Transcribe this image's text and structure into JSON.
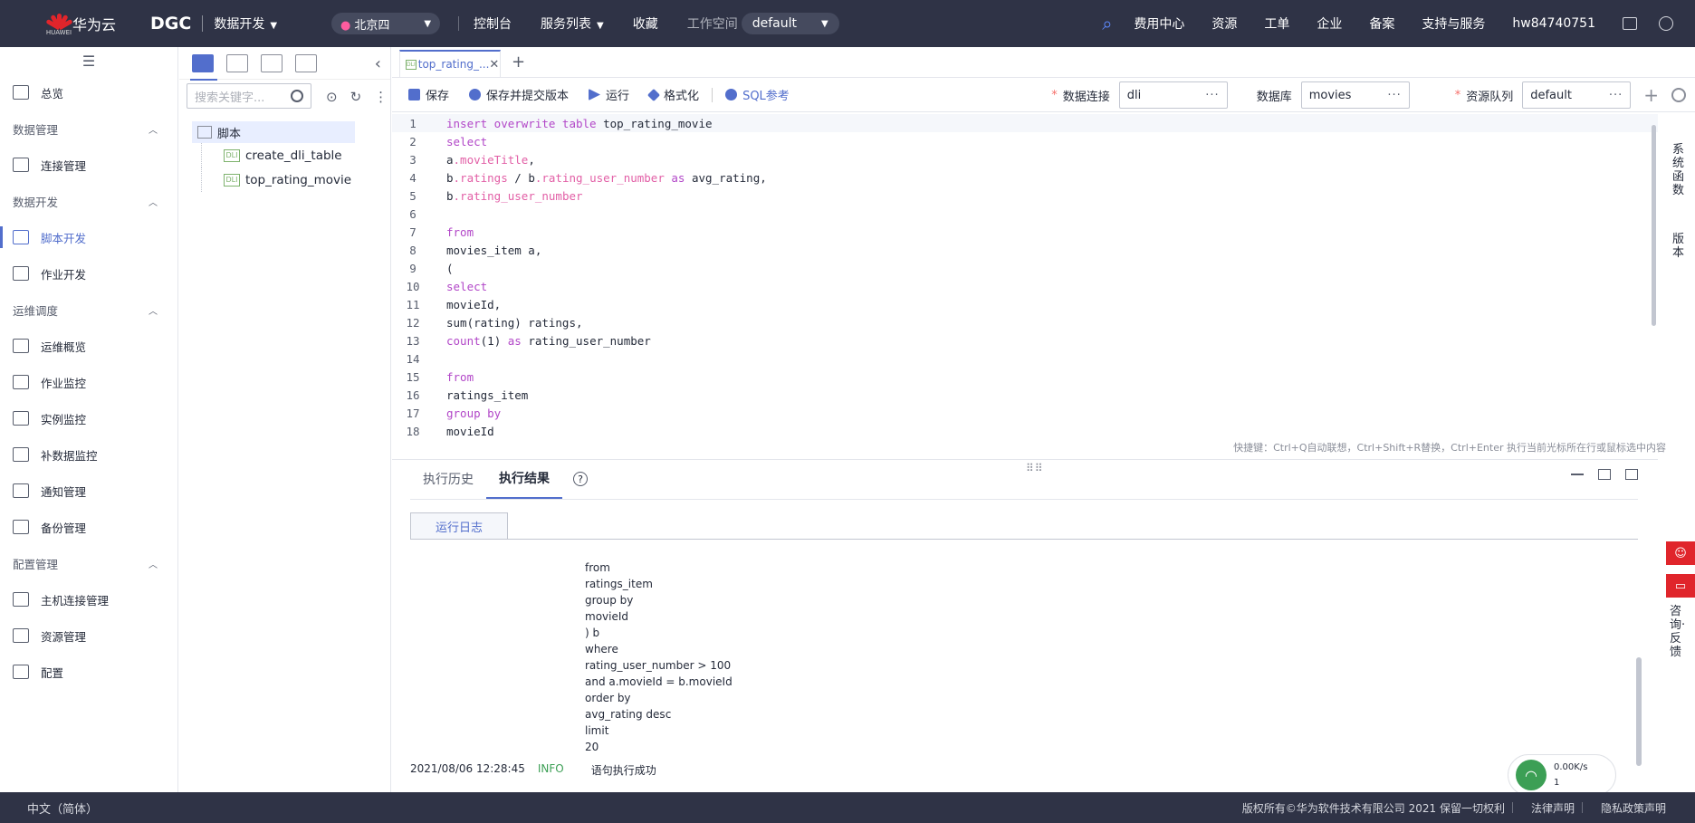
{
  "topbar": {
    "logo_sub": "HUAWEI",
    "brand": "华为云",
    "product": "DGC",
    "module": "数据开发",
    "region": "北京四",
    "nav": [
      "控制台",
      "服务列表",
      "收藏"
    ],
    "workspace_label": "工作空间",
    "workspace_value": "default",
    "right_links": [
      "费用中心",
      "资源",
      "工单",
      "企业",
      "备案",
      "支持与服务",
      "hw84740751"
    ]
  },
  "sidebar": {
    "overview": "总览",
    "groups": [
      {
        "title": "数据管理",
        "items": [
          "连接管理"
        ]
      },
      {
        "title": "数据开发",
        "items": [
          "脚本开发",
          "作业开发"
        ]
      },
      {
        "title": "运维调度",
        "items": [
          "运维概览",
          "作业监控",
          "实例监控",
          "补数据监控",
          "通知管理",
          "备份管理"
        ]
      },
      {
        "title": "配置管理",
        "items": [
          "主机连接管理",
          "资源管理",
          "配置"
        ]
      }
    ]
  },
  "explorer": {
    "search_placeholder": "搜索关键字...",
    "root": "脚本",
    "files": [
      "create_dli_table",
      "top_rating_movie"
    ],
    "file_icon_label": "DLI"
  },
  "editor": {
    "tab_label": "top_rating_...",
    "toolbar": {
      "save": "保存",
      "save_submit": "保存并提交版本",
      "run": "运行",
      "format": "格式化",
      "sql_ref": "SQL参考"
    },
    "fields": {
      "connection_label": "数据连接",
      "connection_value": "dli",
      "database_label": "数据库",
      "database_value": "movies",
      "queue_label": "资源队列",
      "queue_value": "default"
    },
    "shortcut_hint": "快捷键：Ctrl+Q自动联想，Ctrl+Shift+R替换，Ctrl+Enter 执行当前光标所在行或鼠标选中内容"
  },
  "results": {
    "tabs": [
      "执行历史",
      "执行结果"
    ],
    "help": "?",
    "log_tab": "运行日志",
    "log_lines": [
      "from",
      "ratings_item",
      "group by",
      "movieId",
      ") b",
      "where",
      "rating_user_number > 100",
      "and a.movieId = b.movieId",
      "order by",
      "avg_rating desc",
      "limit",
      "20"
    ],
    "log_time": "2021/08/06 12:28:45",
    "log_level": "INFO",
    "log_msg": "语句执行成功"
  },
  "network": {
    "speed": "0.00K/s",
    "count": "1"
  },
  "right_rail": {
    "sys_func": "系统函数",
    "version": "版本",
    "feedback": "咨询·反馈"
  },
  "footer": {
    "language": "中文（简体）",
    "copyright": "版权所有©华为软件技术有限公司 2021 保留一切权利",
    "legal": "法律声明",
    "privacy": "隐私政策声明"
  }
}
